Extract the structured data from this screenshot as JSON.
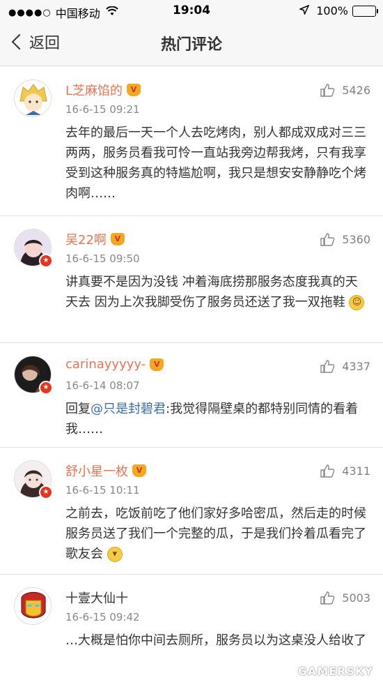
{
  "status_bar": {
    "signal": "●●●●○",
    "carrier": "中国移动",
    "time": "19:04",
    "battery": "100%"
  },
  "nav": {
    "back_label": "返回",
    "title": "热门评论"
  },
  "comments": [
    {
      "username": "L芝麻馅的",
      "time": "16-6-15 09:21",
      "likes": "5426",
      "text": "去年的最后一天一个人去吃烤肉，别人都成双成对三三两两，服务员看我可怜一直站我旁边帮我烤，只有我享受到这种服务真的特尴尬啊，我只是想安安静静吃个烤肉啊……"
    },
    {
      "username": "吴22啊",
      "time": "16-6-15 09:50",
      "likes": "5360",
      "text": "讲真要不是因为没钱 冲着海底捞那服务态度我真的天天去 因为上次我脚受伤了服务员还送了我一双拖鞋"
    },
    {
      "username": "carinayyyyy-",
      "time": "16-6-14 08:07",
      "likes": "4337",
      "reply_prefix": "回复",
      "mention": "@只是封碧君",
      "text": ":我觉得隔壁桌的都特别同情的看着我……"
    },
    {
      "username": "舒小星一枚",
      "time": "16-6-15 10:11",
      "likes": "4311",
      "text": "之前去，吃饭前吃了他们家好多哈密瓜，然后走的时候服务员送了我们一个完整的瓜，于是我们拎着瓜看完了歌友会"
    },
    {
      "username": "十壹大仙十",
      "time": "16-6-15 09:42",
      "likes": "5003",
      "text": "…大概是怕你中间去厕所，服务员以为这桌没人给收了"
    }
  ],
  "watermark": "GAMERSKY",
  "colors": {
    "username": "#eb7350",
    "mention": "#3b6ea8",
    "battery": "#3cc14a"
  }
}
